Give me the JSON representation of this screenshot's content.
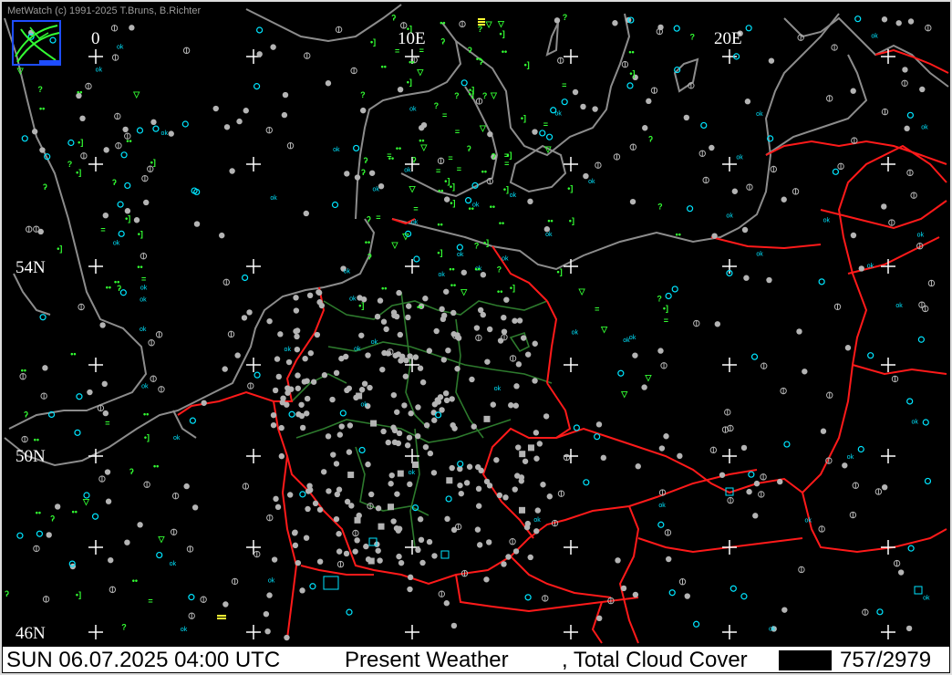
{
  "app": {
    "copyright": "MetWatch  (c) 1991-2025 T.Bruns, B.Richter",
    "logo_icon": "metwatch-logo-icon"
  },
  "map": {
    "projection_labels": {
      "lon_0": "0",
      "lon_10": "10E",
      "lon_20": "20E",
      "lat_54": "54N",
      "lat_50": "50N",
      "lat_46": "46N"
    },
    "colors": {
      "background": "#000000",
      "coastline": "#8c8c8c",
      "country_border": "#ff1a1a",
      "state_border": "#2d7a2d",
      "grid_cross": "#ffffff",
      "cloud_station": "#b4b4b4",
      "ok_marker": "#00e5ff",
      "present_weather": "#33ff33",
      "highlight": "#ffff33"
    }
  },
  "status": {
    "datetime": "SUN 06.07.2025 04:00 UTC",
    "product": "Present Weather",
    "product2": ", Total Cloud Cover",
    "count": "757/2979"
  },
  "legend_ok": "OK"
}
